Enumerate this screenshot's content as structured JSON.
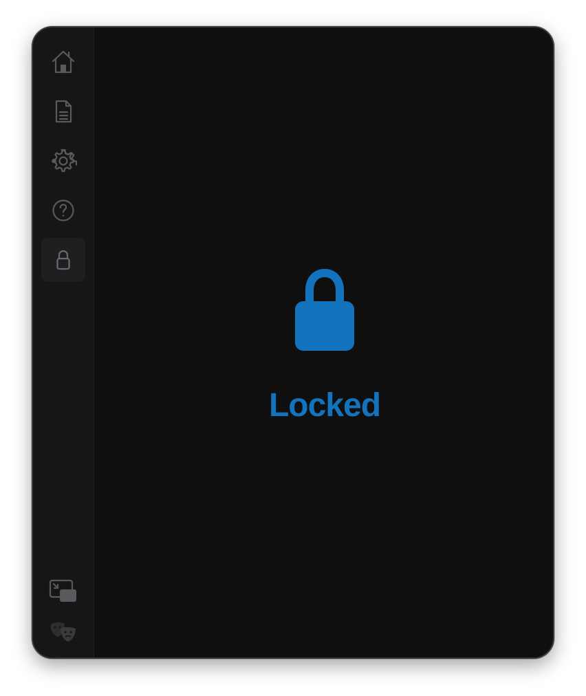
{
  "lock_screen": {
    "title": "Locked",
    "accent_color": "#1473bd",
    "icon": "lock-icon"
  },
  "sidebar": {
    "items": [
      {
        "name": "home",
        "icon": "home-icon"
      },
      {
        "name": "document",
        "icon": "document-icon"
      },
      {
        "name": "settings",
        "icon": "gear-icon"
      },
      {
        "name": "help",
        "icon": "help-icon"
      },
      {
        "name": "lock",
        "icon": "lock-icon",
        "active": true
      }
    ],
    "bottom_items": [
      {
        "name": "picture-in-picture",
        "icon": "picture-in-picture-icon"
      },
      {
        "name": "theater-masks",
        "icon": "theater-masks-icon"
      }
    ]
  }
}
